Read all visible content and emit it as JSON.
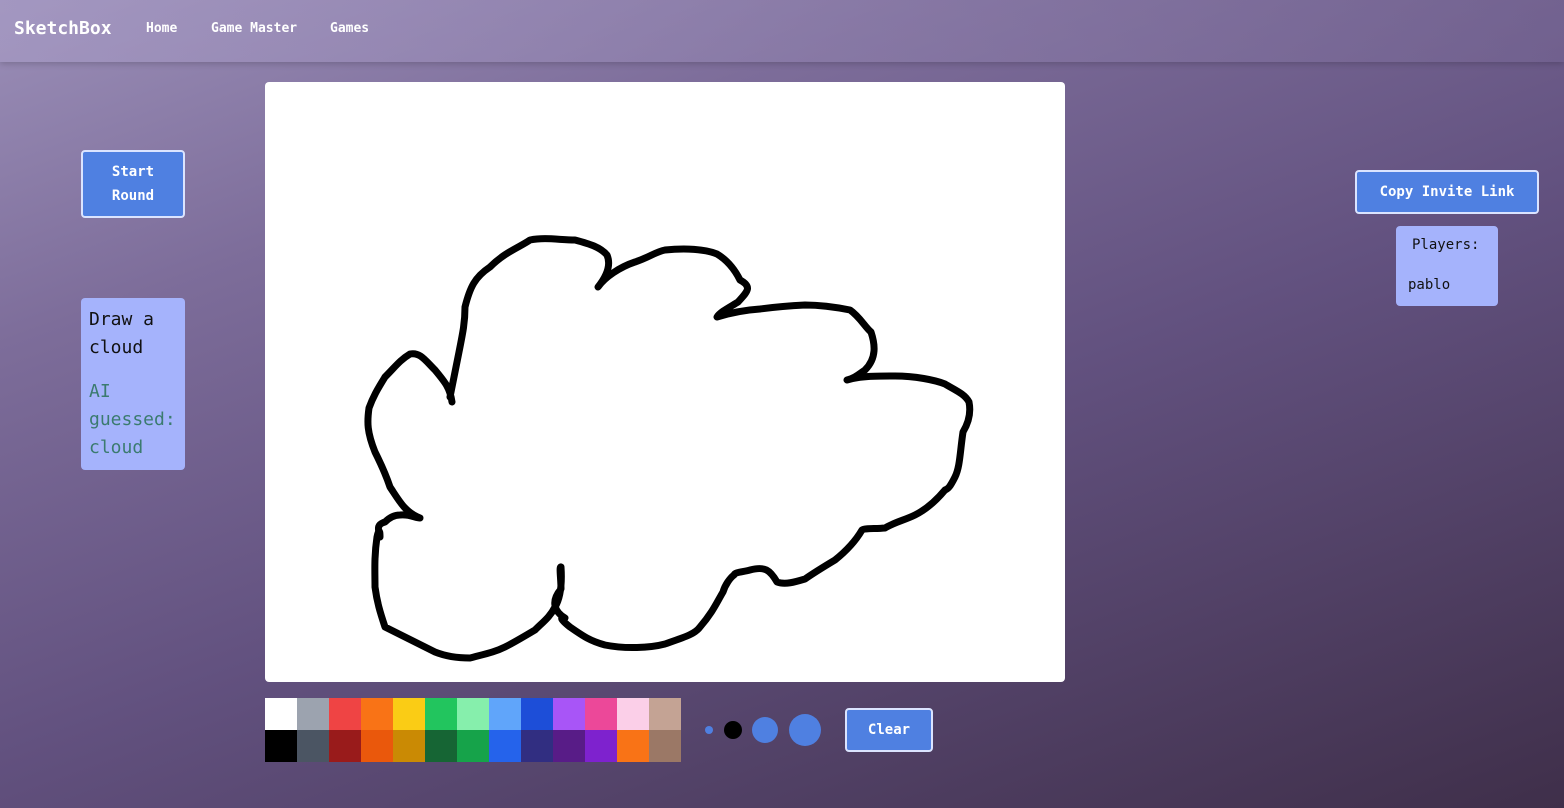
{
  "navbar": {
    "brand": "SketchBox",
    "links": [
      "Home",
      "Game Master",
      "Games"
    ]
  },
  "controls": {
    "start_round_line1": "Start",
    "start_round_line2": "Round",
    "copy_invite": "Copy Invite Link",
    "clear": "Clear"
  },
  "prompt": {
    "line1": "Draw a",
    "line2": "cloud",
    "guess_line1": "AI",
    "guess_line2": "guessed:",
    "guess_line3": "cloud"
  },
  "players": {
    "title": "Players:",
    "names": [
      "pablo"
    ]
  },
  "palette": {
    "top_row": [
      "#ffffff",
      "#9ca3af",
      "#ef4444",
      "#f97316",
      "#facc15",
      "#22c55e",
      "#86efac",
      "#60a5fa",
      "#1d4ed8",
      "#a855f7",
      "#ec4899",
      "#fbcfe8",
      "#c4a394"
    ],
    "bottom_row": [
      "#000000",
      "#4b5563",
      "#991b1b",
      "#ea580c",
      "#ca8a04",
      "#166534",
      "#16a34a",
      "#2563eb",
      "#312e81",
      "#581c87",
      "#7e22ce",
      "#f97316",
      "#9b7866"
    ]
  },
  "brushes": [
    {
      "name": "brush-size-small",
      "color": "#4f80e1"
    },
    {
      "name": "brush-size-medium-selected",
      "color": "#000000"
    },
    {
      "name": "brush-size-large",
      "color": "#4f80e1"
    },
    {
      "name": "brush-size-xlarge",
      "color": "#4f80e1"
    }
  ],
  "colors": {
    "accent": "#4f80e1",
    "card": "#a5b3fc",
    "guess": "#3b7b6f",
    "stroke": "#000000"
  }
}
